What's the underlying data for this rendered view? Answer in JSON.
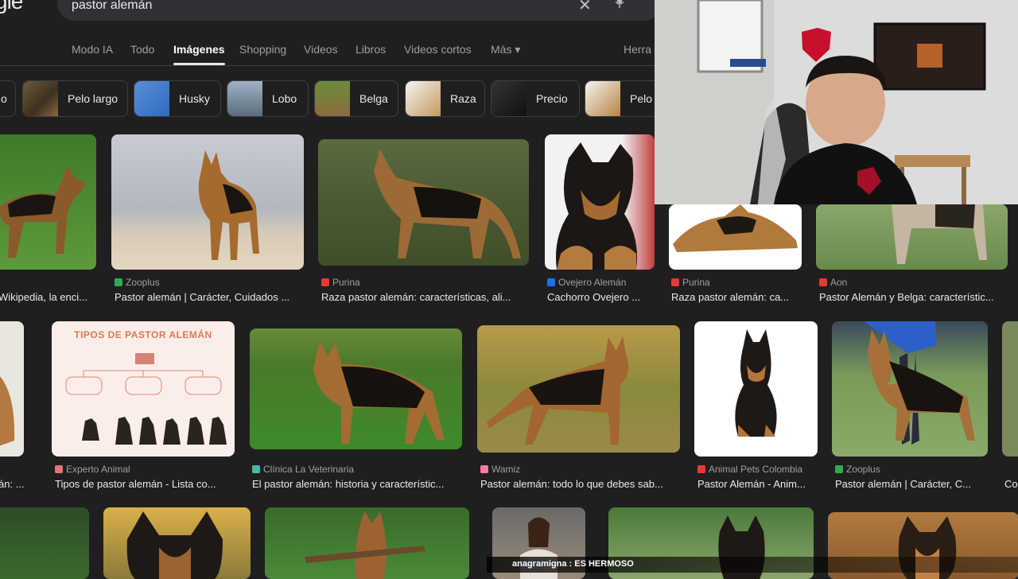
{
  "search": {
    "logo_fragment": "gle",
    "query": "pastor alemán",
    "clear_icon": "close-icon",
    "mic_icon": "mic-icon"
  },
  "tabs": [
    {
      "label": "Modo IA"
    },
    {
      "label": "Todo"
    },
    {
      "label": "Imágenes",
      "active": true
    },
    {
      "label": "Shopping"
    },
    {
      "label": "Videos"
    },
    {
      "label": "Libros"
    },
    {
      "label": "Videos cortos"
    },
    {
      "label": "Más ▾"
    },
    {
      "label": "Herra"
    }
  ],
  "chips": [
    {
      "label": "o"
    },
    {
      "label": "Pelo largo"
    },
    {
      "label": "Husky"
    },
    {
      "label": "Lobo"
    },
    {
      "label": "Belga"
    },
    {
      "label": "Raza"
    },
    {
      "label": "Precio"
    },
    {
      "label": "Pelo c"
    }
  ],
  "results": {
    "row1": [
      {
        "source": "",
        "caption": "Wikipedia, la enci..."
      },
      {
        "source": "Zooplus",
        "caption": "Pastor alemán | Carácter, Cuidados ..."
      },
      {
        "source": "Purina",
        "caption": "Raza pastor alemán: características, ali..."
      },
      {
        "source": "Ovejero Alemán",
        "caption": "Cachorro Ovejero ..."
      },
      {
        "source": "Purina",
        "caption": "Raza pastor alemán: ca..."
      },
      {
        "source": "Aon",
        "caption": "Pastor Alemán y Belga: característic..."
      }
    ],
    "row2": [
      {
        "source": "",
        "caption": "án: ..."
      },
      {
        "source": "Experto Animal",
        "caption": "Tipos de pastor alemán - Lista co..."
      },
      {
        "source": "Clínica La Veterinaria",
        "caption": "El pastor alemán: historia y característic..."
      },
      {
        "source": "Wamiz",
        "caption": "Pastor alemán: todo lo que debes sab..."
      },
      {
        "source": "Animal Pets Colombia",
        "caption": "Pastor Alemán - Anim..."
      },
      {
        "source": "Zooplus",
        "caption": "Pastor alemán | Carácter, C..."
      },
      {
        "source": "",
        "caption": "Co"
      }
    ]
  },
  "infographic": {
    "title": "TIPOS DE PASTOR ALEMÁN"
  },
  "chat_overlay": {
    "text": "anagramigna : ES HERMOSO"
  },
  "colors": {
    "bg": "#1f1f1f",
    "chip_border": "#3c4043",
    "text_muted": "#9aa0a6",
    "zooplus": "#34a853",
    "purina": "#e53935",
    "aon": "#e53935",
    "wamiz": "#ff7aa2"
  }
}
